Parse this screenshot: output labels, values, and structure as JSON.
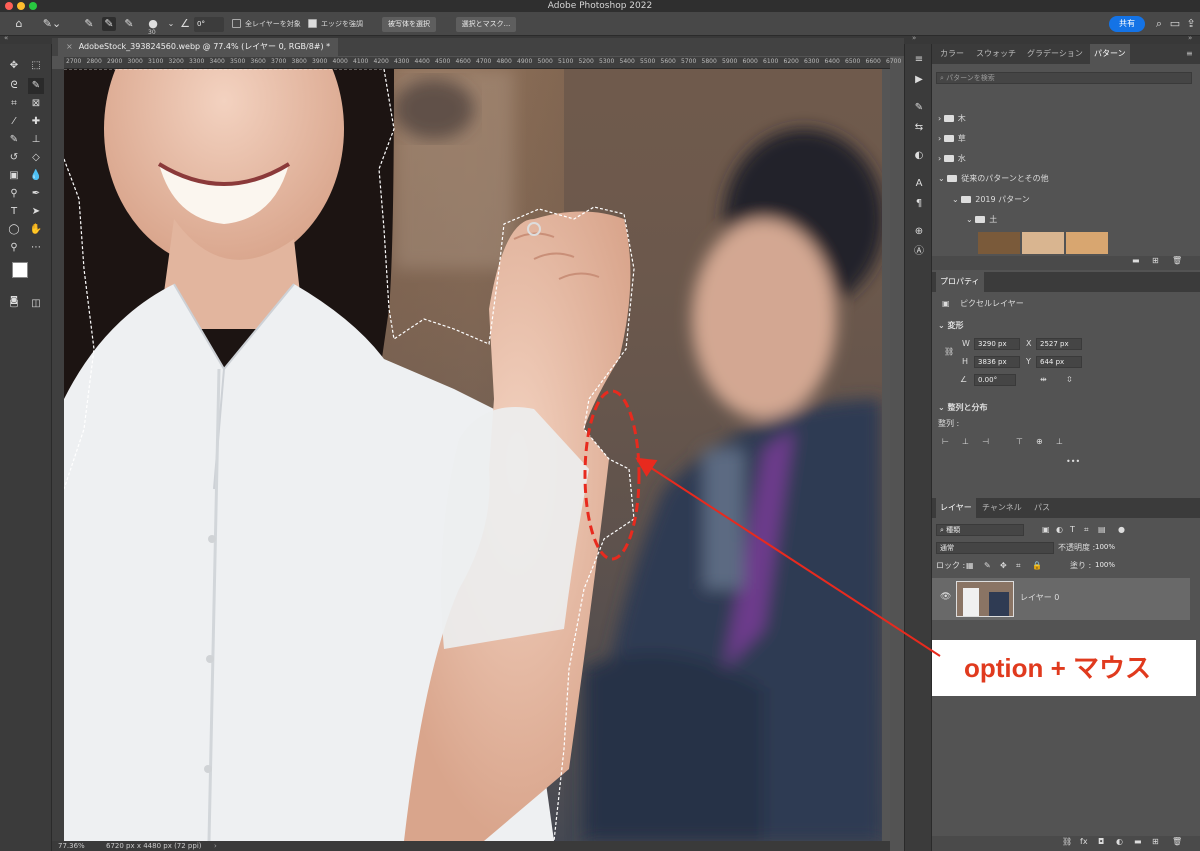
{
  "window": {
    "title": "Adobe Photoshop 2022"
  },
  "options_bar": {
    "brush_size": "30",
    "angle": "0°",
    "sample_all_layers_label": "全レイヤーを対象",
    "enhance_edge_label": "エッジを強調",
    "select_subject_button": "被写体を選択",
    "select_and_mask_button": "選択とマスク...",
    "share_button": "共有"
  },
  "document": {
    "tab_label": "AdobeStock_393824560.webp @ 77.4% (レイヤー 0, RGB/8#) *",
    "status_zoom": "77.36%",
    "status_size": "6720 px x 4480 px (72 ppi)",
    "ruler_ticks": [
      "2700",
      "2800",
      "2900",
      "3000",
      "3100",
      "3200",
      "3300",
      "3400",
      "3500",
      "3600",
      "3700",
      "3800",
      "3900",
      "4000",
      "4100",
      "4200",
      "4300",
      "4400",
      "4500",
      "4600",
      "4700",
      "4800",
      "4900",
      "5000",
      "5100",
      "5200",
      "5300",
      "5400",
      "5500",
      "5600",
      "5700",
      "5800",
      "5900",
      "6000",
      "6100",
      "6200",
      "6300",
      "6400",
      "6500",
      "6600",
      "6700"
    ]
  },
  "patterns_panel": {
    "tabs": [
      "カラー",
      "スウォッチ",
      "グラデーション",
      "パターン"
    ],
    "search_placeholder": "パターンを検索",
    "folders": [
      "木",
      "草",
      "水",
      "従来のパターンとその他"
    ],
    "subfolder": "2019 パターン",
    "subsubfolder": "土"
  },
  "properties_panel": {
    "tab": "プロパティ",
    "layer_type": "ピクセルレイヤー",
    "transform_label": "変形",
    "w_label": "W",
    "w_value": "3290 px",
    "h_label": "H",
    "h_value": "3836 px",
    "x_label": "X",
    "x_value": "2527 px",
    "y_label": "Y",
    "y_value": "644 px",
    "angle_value": "0.00°",
    "align_label": "整列と分布",
    "align_sub": "整列 :",
    "more": "•••"
  },
  "layers_panel": {
    "tabs": [
      "レイヤー",
      "チャンネル",
      "パス"
    ],
    "filter_kind": "種類",
    "blend_mode": "通常",
    "opacity_label": "不透明度 :",
    "opacity_value": "100%",
    "lock_label": "ロック :",
    "fill_label": "塗り :",
    "fill_value": "100%",
    "layer_name": "レイヤー 0"
  },
  "annotation": {
    "text": "option + マウス",
    "color": "#e03a1e"
  },
  "colors": {
    "accent": "#1473e6",
    "panel_bg": "#535353",
    "toolbar_bg": "#3b3b3b"
  }
}
